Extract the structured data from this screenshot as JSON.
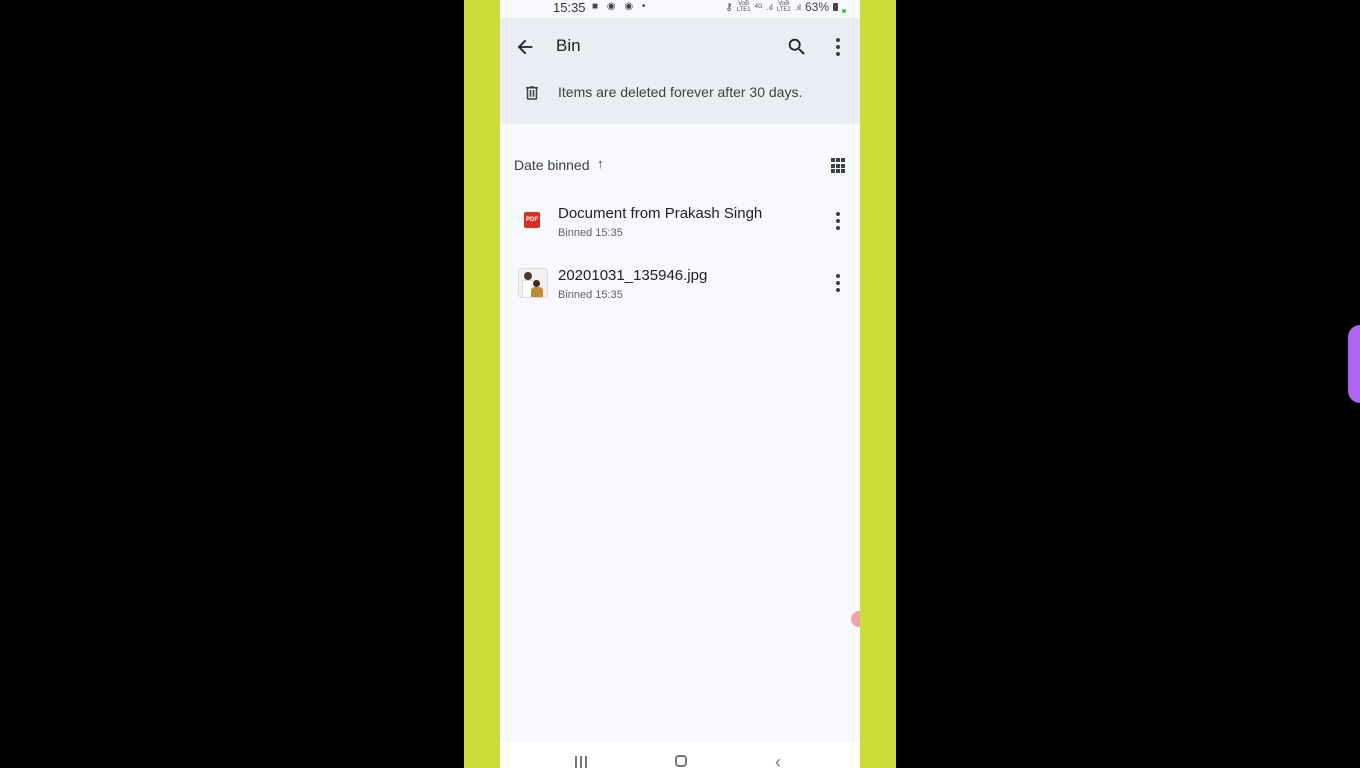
{
  "status_bar": {
    "time": "15:35",
    "left_icons": [
      "video-icon",
      "chrome-icon",
      "chrome-icon",
      "dot-icon"
    ],
    "carrier1_top": "VoB",
    "carrier1_bottom": "LTE1",
    "network_type": "4G",
    "carrier2_top": "VoB",
    "carrier2_bottom": "LTE2",
    "battery": "63%"
  },
  "header": {
    "title": "Bin",
    "back_icon": "arrow-left-icon",
    "search_icon": "search-icon",
    "menu_icon": "more-vert-icon"
  },
  "notice": {
    "icon": "trash-icon",
    "text": "Items are deleted forever after 30 days."
  },
  "sort": {
    "label": "Date binned",
    "direction_glyph": "↑",
    "view_icon": "grid-view-icon"
  },
  "files": [
    {
      "name": "Document from Prakash Singh",
      "subtitle": "Binned 15:35",
      "type": "pdf",
      "icon_label": "PDF"
    },
    {
      "name": "20201031_135946.jpg",
      "subtitle": "Binned 15:35",
      "type": "image"
    }
  ],
  "nav": {
    "back_glyph": "‹"
  },
  "colors": {
    "frame": "#cddc39",
    "header_bg": "#e8eef4",
    "pdf_red": "#d93025",
    "side_handle": "#b064f5"
  }
}
